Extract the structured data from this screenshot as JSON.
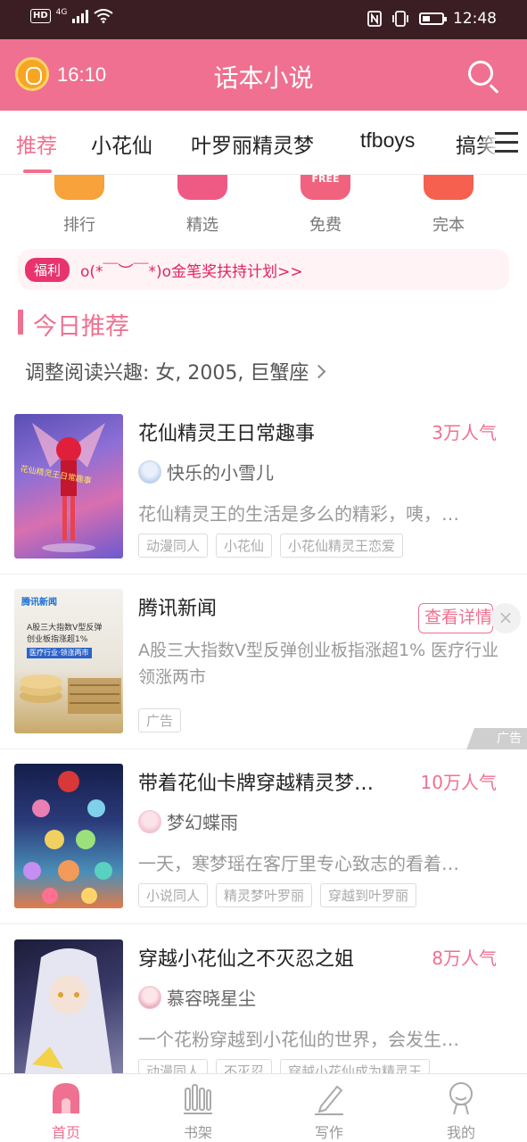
{
  "status_bar": {
    "hd": "HD",
    "network": "4G",
    "time": "12:48"
  },
  "header": {
    "alarm_time": "16:10",
    "title": "话本小说"
  },
  "tabs": [
    {
      "label": "推荐",
      "active": true
    },
    {
      "label": "小花仙"
    },
    {
      "label": "叶罗丽精灵梦"
    },
    {
      "label": "tfboys"
    },
    {
      "label": "搞笑"
    }
  ],
  "categories": [
    {
      "label": "排行",
      "color": "#f7a23a"
    },
    {
      "label": "精选",
      "color": "#ef5a85"
    },
    {
      "label": "免费",
      "color": "#f0627e",
      "icon_text": "FREE"
    },
    {
      "label": "完本",
      "color": "#f6604e"
    }
  ],
  "welfare": {
    "badge": "福利",
    "text": "o(*￣︶￣*)o金笔奖扶持计划>>"
  },
  "section": {
    "title": "今日推荐",
    "interest": "调整阅读兴趣: 女, 2005, 巨蟹座"
  },
  "books": [
    {
      "title": "花仙精灵王日常趣事",
      "popularity": "3万人气",
      "author": "快乐的小雪儿",
      "description": "花仙精灵王的生活是多么的精彩，咦，…",
      "tags": [
        "动漫同人",
        "小花仙",
        "小花仙精灵王恋爱"
      ],
      "cover_text": "花仙精灵王日常趣事"
    },
    {
      "title": "带着花仙卡牌穿越精灵梦…",
      "popularity": "10万人气",
      "author": "梦幻蝶雨",
      "description": "一天，寒梦瑶在客厅里专心致志的看着…",
      "tags": [
        "小说同人",
        "精灵梦叶罗丽",
        "穿越到叶罗丽"
      ]
    },
    {
      "title": "穿越小花仙之不灭忍之姐",
      "popularity": "8万人气",
      "author": "慕容晓星尘",
      "description": "一个花粉穿越到小花仙的世界，会发生…",
      "tags": [
        "动漫同人",
        "不灭忍",
        "穿越小花仙成为精灵王"
      ]
    }
  ],
  "ad": {
    "title": "腾讯新闻",
    "description": "A股三大指数V型反弹创业板指涨超1%  医疗行业领涨两市",
    "button": "查看详情",
    "label": "广告",
    "corner_label": "广告",
    "close": "×",
    "image_brand": "腾讯新闻",
    "image_lines": [
      "A股三大指数V型反弹",
      "创业板指涨超1%",
      "医疗行业·领涨两市"
    ]
  },
  "bottom_nav": [
    {
      "label": "首页",
      "active": true,
      "icon": "home-icon"
    },
    {
      "label": "书架",
      "icon": "bookshelf-icon"
    },
    {
      "label": "写作",
      "icon": "pen-icon"
    },
    {
      "label": "我的",
      "icon": "profile-icon"
    }
  ],
  "colors": {
    "accent": "#ef7090",
    "status_bar": "#3b1e24"
  }
}
